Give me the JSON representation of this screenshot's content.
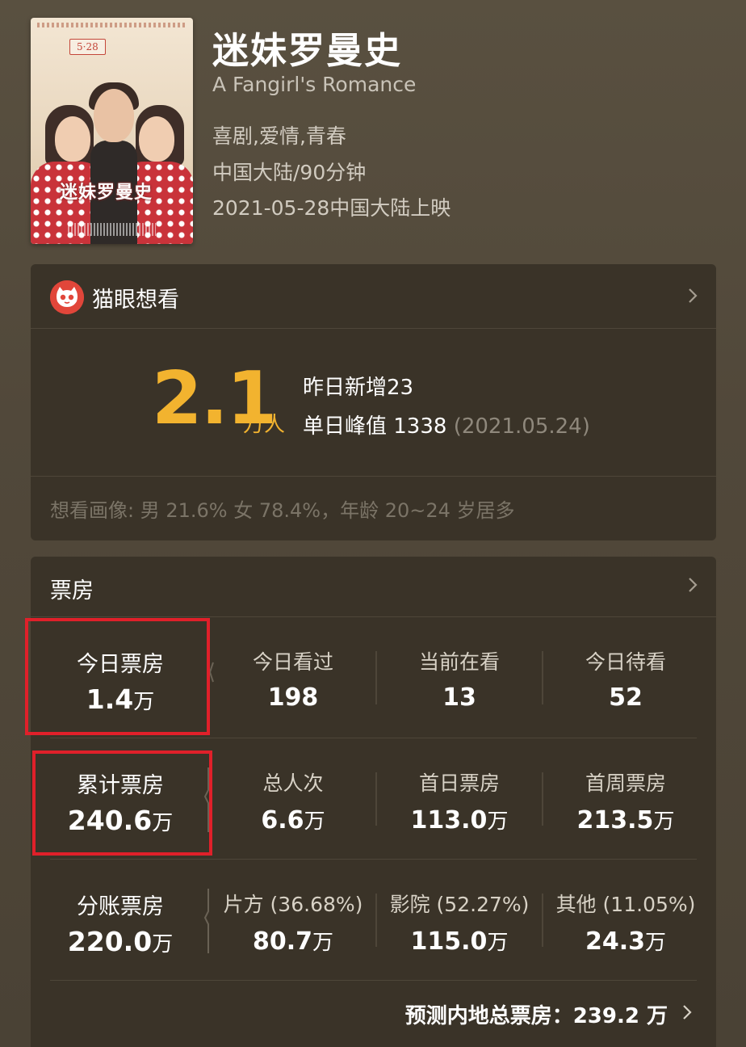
{
  "movie": {
    "title": "迷妹罗曼史",
    "english_title": "A Fangirl's Romance",
    "genres": "喜剧,爱情,青春",
    "region_duration": "中国大陆/90分钟",
    "release": "2021-05-28中国大陆上映",
    "poster": {
      "date_badge": "5·28",
      "title_art": "迷妹罗曼史"
    }
  },
  "want_card": {
    "logo_icon": "maoyan-cat-icon",
    "title": "猫眼想看",
    "big_number": "2.1",
    "big_unit": "万人",
    "yesterday_new": "昨日新增23",
    "daily_peak": "单日峰值 1338",
    "daily_peak_date": "(2021.05.24)",
    "audience_portrait": "想看画像: 男 21.6%  女 78.4%，年龄 20~24 岁居多"
  },
  "box_office": {
    "title": "票房",
    "rows": [
      {
        "main": {
          "label": "今日票房",
          "value": "1.4",
          "unit": "万"
        },
        "cells": [
          {
            "label": "今日看过",
            "value": "198",
            "unit": ""
          },
          {
            "label": "当前在看",
            "value": "13",
            "unit": ""
          },
          {
            "label": "今日待看",
            "value": "52",
            "unit": ""
          }
        ]
      },
      {
        "main": {
          "label": "累计票房",
          "value": "240.6",
          "unit": "万"
        },
        "cells": [
          {
            "label": "总人次",
            "value": "6.6",
            "unit": "万"
          },
          {
            "label": "首日票房",
            "value": "113.0",
            "unit": "万"
          },
          {
            "label": "首周票房",
            "value": "213.5",
            "unit": "万"
          }
        ]
      },
      {
        "main": {
          "label": "分账票房",
          "value": "220.0",
          "unit": "万"
        },
        "cells": [
          {
            "label": "片方 (36.68%)",
            "value": "80.7",
            "unit": "万"
          },
          {
            "label": "影院 (52.27%)",
            "value": "115.0",
            "unit": "万"
          },
          {
            "label": "其他 (11.05%)",
            "value": "24.3",
            "unit": "万"
          }
        ]
      }
    ],
    "forecast": "预测内地总票房：239.2 万"
  },
  "colors": {
    "accent": "#f2b32f",
    "highlight": "#e0202a",
    "maoyan_red": "#e1463a"
  }
}
